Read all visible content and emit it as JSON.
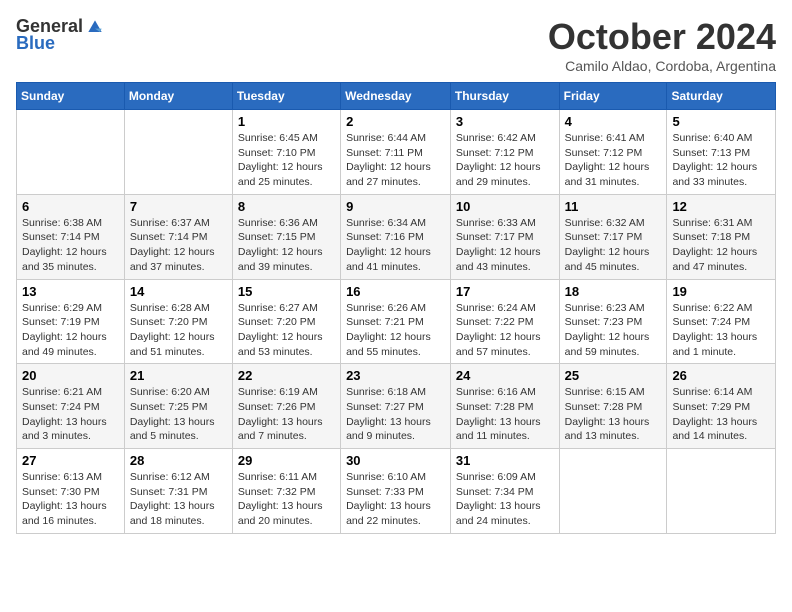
{
  "logo": {
    "general": "General",
    "blue": "Blue"
  },
  "title": "October 2024",
  "subtitle": "Camilo Aldao, Cordoba, Argentina",
  "days_of_week": [
    "Sunday",
    "Monday",
    "Tuesday",
    "Wednesday",
    "Thursday",
    "Friday",
    "Saturday"
  ],
  "weeks": [
    [
      {
        "day": "",
        "info": ""
      },
      {
        "day": "",
        "info": ""
      },
      {
        "day": "1",
        "info": "Sunrise: 6:45 AM\nSunset: 7:10 PM\nDaylight: 12 hours and 25 minutes."
      },
      {
        "day": "2",
        "info": "Sunrise: 6:44 AM\nSunset: 7:11 PM\nDaylight: 12 hours and 27 minutes."
      },
      {
        "day": "3",
        "info": "Sunrise: 6:42 AM\nSunset: 7:12 PM\nDaylight: 12 hours and 29 minutes."
      },
      {
        "day": "4",
        "info": "Sunrise: 6:41 AM\nSunset: 7:12 PM\nDaylight: 12 hours and 31 minutes."
      },
      {
        "day": "5",
        "info": "Sunrise: 6:40 AM\nSunset: 7:13 PM\nDaylight: 12 hours and 33 minutes."
      }
    ],
    [
      {
        "day": "6",
        "info": "Sunrise: 6:38 AM\nSunset: 7:14 PM\nDaylight: 12 hours and 35 minutes."
      },
      {
        "day": "7",
        "info": "Sunrise: 6:37 AM\nSunset: 7:14 PM\nDaylight: 12 hours and 37 minutes."
      },
      {
        "day": "8",
        "info": "Sunrise: 6:36 AM\nSunset: 7:15 PM\nDaylight: 12 hours and 39 minutes."
      },
      {
        "day": "9",
        "info": "Sunrise: 6:34 AM\nSunset: 7:16 PM\nDaylight: 12 hours and 41 minutes."
      },
      {
        "day": "10",
        "info": "Sunrise: 6:33 AM\nSunset: 7:17 PM\nDaylight: 12 hours and 43 minutes."
      },
      {
        "day": "11",
        "info": "Sunrise: 6:32 AM\nSunset: 7:17 PM\nDaylight: 12 hours and 45 minutes."
      },
      {
        "day": "12",
        "info": "Sunrise: 6:31 AM\nSunset: 7:18 PM\nDaylight: 12 hours and 47 minutes."
      }
    ],
    [
      {
        "day": "13",
        "info": "Sunrise: 6:29 AM\nSunset: 7:19 PM\nDaylight: 12 hours and 49 minutes."
      },
      {
        "day": "14",
        "info": "Sunrise: 6:28 AM\nSunset: 7:20 PM\nDaylight: 12 hours and 51 minutes."
      },
      {
        "day": "15",
        "info": "Sunrise: 6:27 AM\nSunset: 7:20 PM\nDaylight: 12 hours and 53 minutes."
      },
      {
        "day": "16",
        "info": "Sunrise: 6:26 AM\nSunset: 7:21 PM\nDaylight: 12 hours and 55 minutes."
      },
      {
        "day": "17",
        "info": "Sunrise: 6:24 AM\nSunset: 7:22 PM\nDaylight: 12 hours and 57 minutes."
      },
      {
        "day": "18",
        "info": "Sunrise: 6:23 AM\nSunset: 7:23 PM\nDaylight: 12 hours and 59 minutes."
      },
      {
        "day": "19",
        "info": "Sunrise: 6:22 AM\nSunset: 7:24 PM\nDaylight: 13 hours and 1 minute."
      }
    ],
    [
      {
        "day": "20",
        "info": "Sunrise: 6:21 AM\nSunset: 7:24 PM\nDaylight: 13 hours and 3 minutes."
      },
      {
        "day": "21",
        "info": "Sunrise: 6:20 AM\nSunset: 7:25 PM\nDaylight: 13 hours and 5 minutes."
      },
      {
        "day": "22",
        "info": "Sunrise: 6:19 AM\nSunset: 7:26 PM\nDaylight: 13 hours and 7 minutes."
      },
      {
        "day": "23",
        "info": "Sunrise: 6:18 AM\nSunset: 7:27 PM\nDaylight: 13 hours and 9 minutes."
      },
      {
        "day": "24",
        "info": "Sunrise: 6:16 AM\nSunset: 7:28 PM\nDaylight: 13 hours and 11 minutes."
      },
      {
        "day": "25",
        "info": "Sunrise: 6:15 AM\nSunset: 7:28 PM\nDaylight: 13 hours and 13 minutes."
      },
      {
        "day": "26",
        "info": "Sunrise: 6:14 AM\nSunset: 7:29 PM\nDaylight: 13 hours and 14 minutes."
      }
    ],
    [
      {
        "day": "27",
        "info": "Sunrise: 6:13 AM\nSunset: 7:30 PM\nDaylight: 13 hours and 16 minutes."
      },
      {
        "day": "28",
        "info": "Sunrise: 6:12 AM\nSunset: 7:31 PM\nDaylight: 13 hours and 18 minutes."
      },
      {
        "day": "29",
        "info": "Sunrise: 6:11 AM\nSunset: 7:32 PM\nDaylight: 13 hours and 20 minutes."
      },
      {
        "day": "30",
        "info": "Sunrise: 6:10 AM\nSunset: 7:33 PM\nDaylight: 13 hours and 22 minutes."
      },
      {
        "day": "31",
        "info": "Sunrise: 6:09 AM\nSunset: 7:34 PM\nDaylight: 13 hours and 24 minutes."
      },
      {
        "day": "",
        "info": ""
      },
      {
        "day": "",
        "info": ""
      }
    ]
  ]
}
